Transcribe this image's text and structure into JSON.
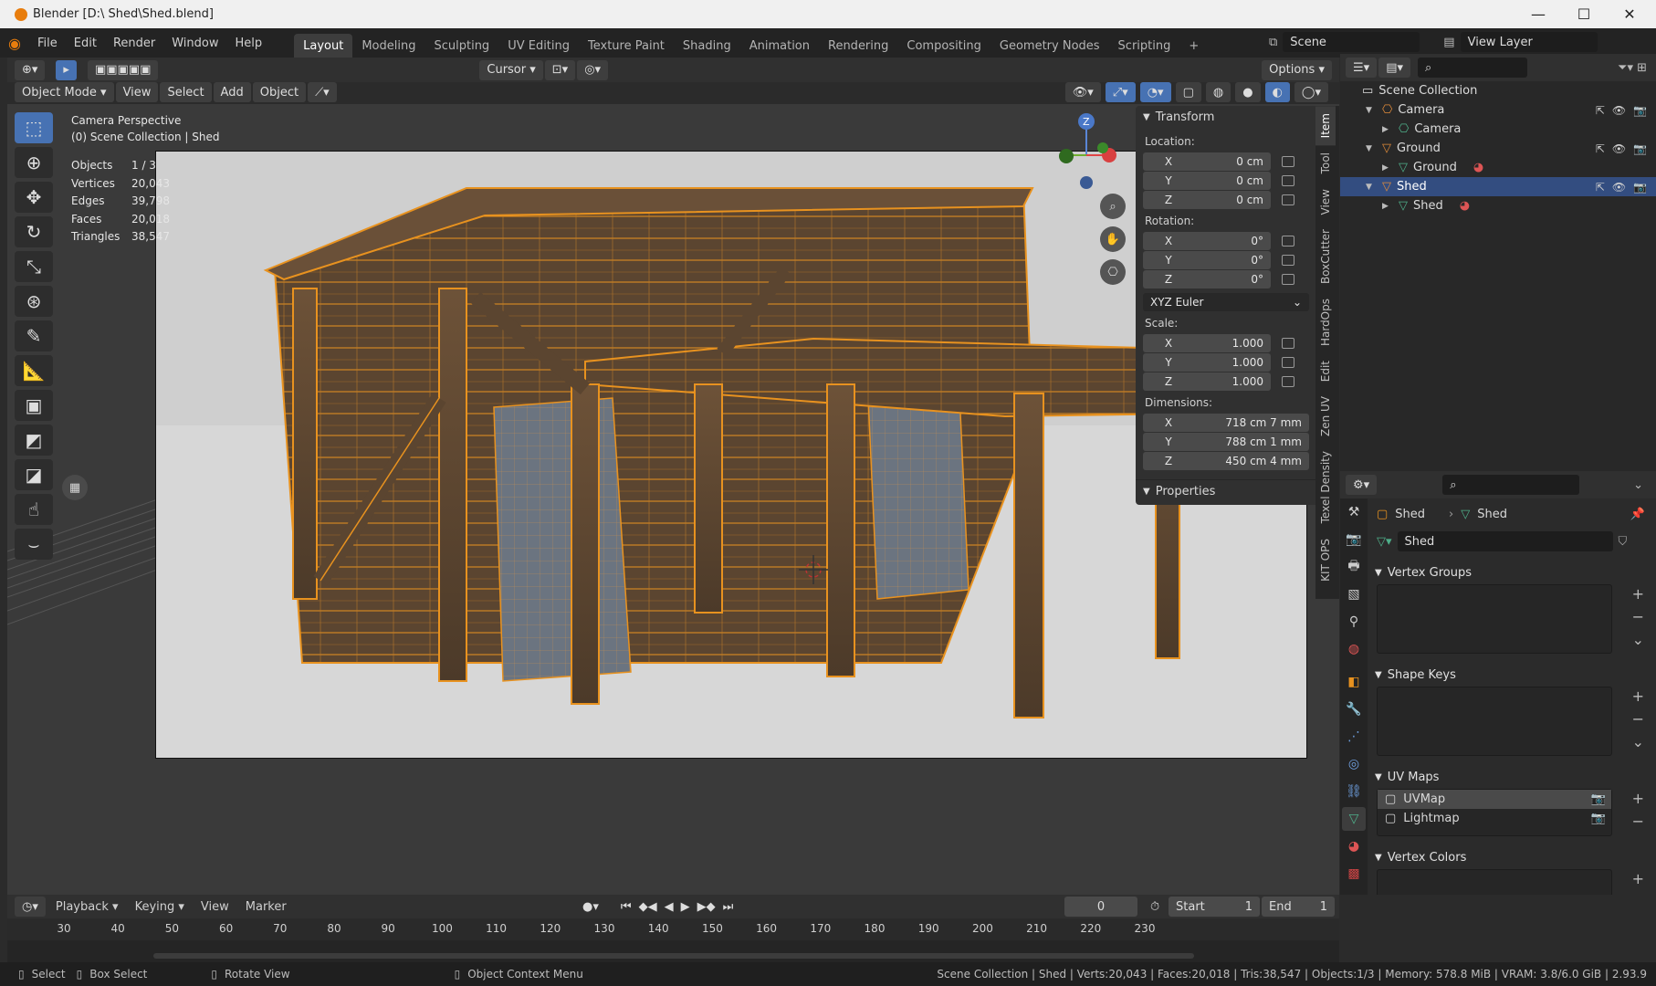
{
  "window": {
    "title": "Blender [D:\\ Shed\\Shed.blend]",
    "controls": {
      "minimize": "—",
      "maximize": "☐",
      "close": "✕"
    }
  },
  "menu": {
    "items": [
      "File",
      "Edit",
      "Render",
      "Window",
      "Help"
    ],
    "workspaces": [
      "Layout",
      "Modeling",
      "Sculpting",
      "UV Editing",
      "Texture Paint",
      "Shading",
      "Animation",
      "Rendering",
      "Compositing",
      "Geometry Nodes",
      "Scripting"
    ],
    "active_workspace": "Layout",
    "add_tab": "+",
    "scene": "Scene",
    "view_layer": "View Layer"
  },
  "viewport_header": {
    "mode": "Object Mode",
    "buttons": [
      "View",
      "Select",
      "Add",
      "Object"
    ],
    "pivot": "Cursor",
    "options": "Options"
  },
  "viewport": {
    "camera_label": "Camera Perspective",
    "collection_label": "(0) Scene Collection | Shed",
    "stats": [
      {
        "label": "Objects",
        "value": "1 / 3"
      },
      {
        "label": "Vertices",
        "value": "20,043"
      },
      {
        "label": "Edges",
        "value": "39,798"
      },
      {
        "label": "Faces",
        "value": "20,018"
      },
      {
        "label": "Triangles",
        "value": "38,547"
      }
    ],
    "gizmo": {
      "z": "Z"
    }
  },
  "npanel": {
    "transform_title": "Transform",
    "location_label": "Location:",
    "location": [
      {
        "axis": "X",
        "value": "0 cm"
      },
      {
        "axis": "Y",
        "value": "0 cm"
      },
      {
        "axis": "Z",
        "value": "0 cm"
      }
    ],
    "rotation_label": "Rotation:",
    "rotation": [
      {
        "axis": "X",
        "value": "0°"
      },
      {
        "axis": "Y",
        "value": "0°"
      },
      {
        "axis": "Z",
        "value": "0°"
      }
    ],
    "rotation_mode": "XYZ Euler",
    "scale_label": "Scale:",
    "scale": [
      {
        "axis": "X",
        "value": "1.000"
      },
      {
        "axis": "Y",
        "value": "1.000"
      },
      {
        "axis": "Z",
        "value": "1.000"
      }
    ],
    "dimensions_label": "Dimensions:",
    "dimensions": [
      {
        "axis": "X",
        "value": "718 cm 7 mm"
      },
      {
        "axis": "Y",
        "value": "788 cm 1 mm"
      },
      {
        "axis": "Z",
        "value": "450 cm 4 mm"
      }
    ],
    "properties_title": "Properties",
    "tabs": [
      "Item",
      "Tool",
      "View",
      "BoxCutter",
      "HardOps",
      "Edit",
      "Zen UV",
      "Texel Density",
      "KIT OPS"
    ],
    "active_tab": "Item"
  },
  "outliner": {
    "root": "Scene Collection",
    "rows": [
      {
        "name": "Camera",
        "indent": 1,
        "expanded": true,
        "icon": "camera-object-icon",
        "color": "#e08b3a",
        "selected": false
      },
      {
        "name": "Camera",
        "indent": 2,
        "expanded": false,
        "icon": "camera-data-icon",
        "color": "#4fb08a",
        "selected": false
      },
      {
        "name": "Ground",
        "indent": 1,
        "expanded": true,
        "icon": "mesh-object-icon",
        "color": "#e08b3a",
        "selected": false
      },
      {
        "name": "Ground",
        "indent": 2,
        "expanded": false,
        "icon": "mesh-data-icon",
        "color": "#4fb08a",
        "selected": false
      },
      {
        "name": "Shed",
        "indent": 1,
        "expanded": true,
        "icon": "mesh-object-icon",
        "color": "#e08b3a",
        "selected": true
      },
      {
        "name": "Shed",
        "indent": 2,
        "expanded": false,
        "icon": "mesh-data-icon",
        "color": "#4fb08a",
        "selected": false
      }
    ]
  },
  "properties": {
    "breadcrumb_object": "Shed",
    "breadcrumb_data": "Shed",
    "mesh_name": "Shed",
    "panels": {
      "vertex_groups": "Vertex Groups",
      "shape_keys": "Shape Keys",
      "uv_maps": "UV Maps",
      "vertex_colors": "Vertex Colors"
    },
    "uv_maps": [
      "UVMap",
      "Lightmap"
    ]
  },
  "timeline": {
    "menus": [
      "Playback",
      "Keying",
      "View",
      "Marker"
    ],
    "current_frame": "0",
    "start_label": "Start",
    "start": "1",
    "end_label": "End",
    "end": "1",
    "ruler": [
      "30",
      "40",
      "50",
      "60",
      "70",
      "80",
      "90",
      "100",
      "110",
      "120",
      "130",
      "140",
      "150",
      "160",
      "170",
      "180",
      "190",
      "200",
      "210",
      "220",
      "230"
    ]
  },
  "statusbar": {
    "select": "Select",
    "box_select": "Box Select",
    "rotate_view": "Rotate View",
    "context_menu": "Object Context Menu",
    "stats": "Scene Collection | Shed | Verts:20,043 | Faces:20,018 | Tris:38,547 | Objects:1/3 | Memory: 578.8 MiB | VRAM: 3.8/6.0 GiB | 2.93.9"
  },
  "colors": {
    "accent": "#4772b3",
    "selection_orange": "#e8921f",
    "outliner_selected": "#334d80"
  }
}
